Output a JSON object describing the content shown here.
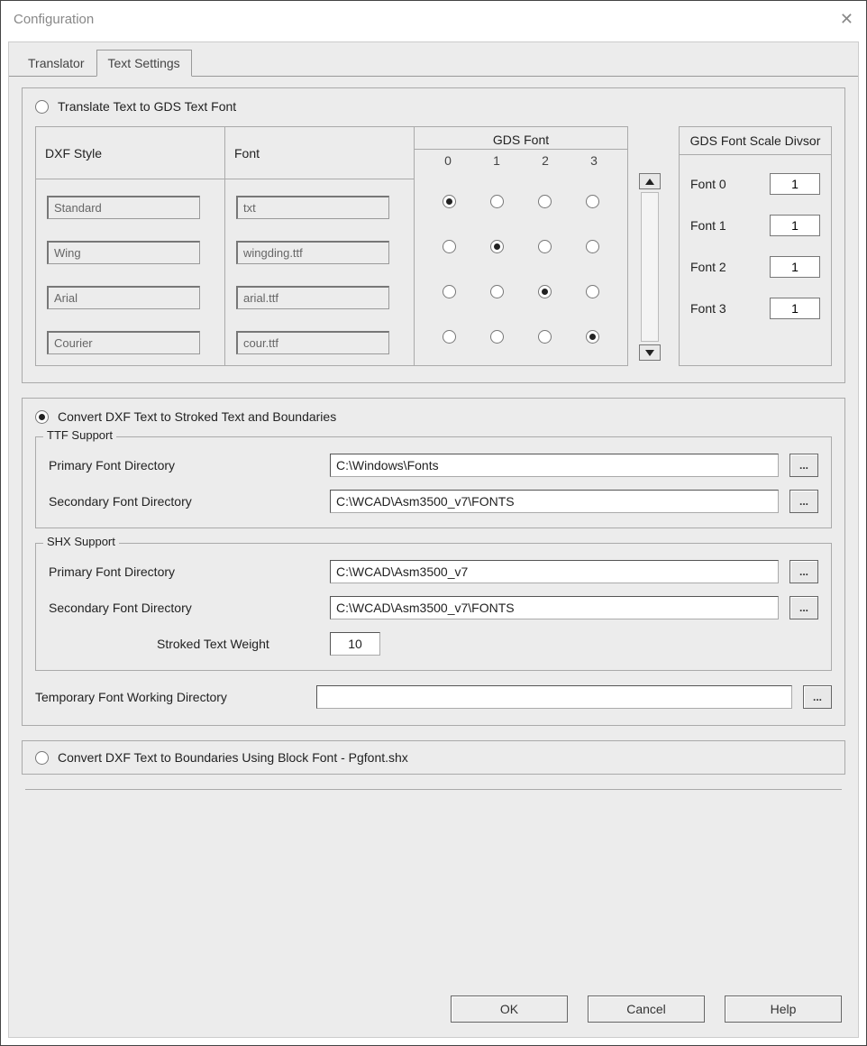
{
  "window": {
    "title": "Configuration"
  },
  "tabs": {
    "translator": "Translator",
    "text_settings": "Text Settings"
  },
  "mode": {
    "translate_gds": "Translate Text to GDS Text Font",
    "convert_stroked": "Convert DXF Text to Stroked Text and Boundaries",
    "convert_block": "Convert DXF Text to Boundaries Using Block Font - Pgfont.shx",
    "selected": "convert_stroked"
  },
  "font_table": {
    "headers": {
      "dxf_style": "DXF Style",
      "font": "Font",
      "gds_font": "GDS Font"
    },
    "gds_cols": [
      "0",
      "1",
      "2",
      "3"
    ],
    "rows": [
      {
        "style": "Standard",
        "font": "txt",
        "gds_selected": 0
      },
      {
        "style": "Wing",
        "font": "wingding.ttf",
        "gds_selected": 1
      },
      {
        "style": "Arial",
        "font": "arial.ttf",
        "gds_selected": 2
      },
      {
        "style": "Courier",
        "font": "cour.ttf",
        "gds_selected": 3
      }
    ]
  },
  "divisor": {
    "header": "GDS Font Scale Divsor",
    "items": [
      {
        "label": "Font 0",
        "value": "1"
      },
      {
        "label": "Font 1",
        "value": "1"
      },
      {
        "label": "Font 2",
        "value": "1"
      },
      {
        "label": "Font 3",
        "value": "1"
      }
    ]
  },
  "ttf": {
    "legend": "TTF Support",
    "primary_label": "Primary Font Directory",
    "primary_value": "C:\\Windows\\Fonts",
    "secondary_label": "Secondary Font Directory",
    "secondary_value": "C:\\WCAD\\Asm3500_v7\\FONTS"
  },
  "shx": {
    "legend": "SHX Support",
    "primary_label": "Primary Font Directory",
    "primary_value": "C:\\WCAD\\Asm3500_v7",
    "secondary_label": "Secondary Font Directory",
    "secondary_value": "C:\\WCAD\\Asm3500_v7\\FONTS",
    "weight_label": "Stroked Text Weight",
    "weight_value": "10"
  },
  "temp_dir": {
    "label": "Temporary Font Working Directory",
    "value": ""
  },
  "buttons": {
    "ok": "OK",
    "cancel": "Cancel",
    "help": "Help",
    "browse": "..."
  }
}
